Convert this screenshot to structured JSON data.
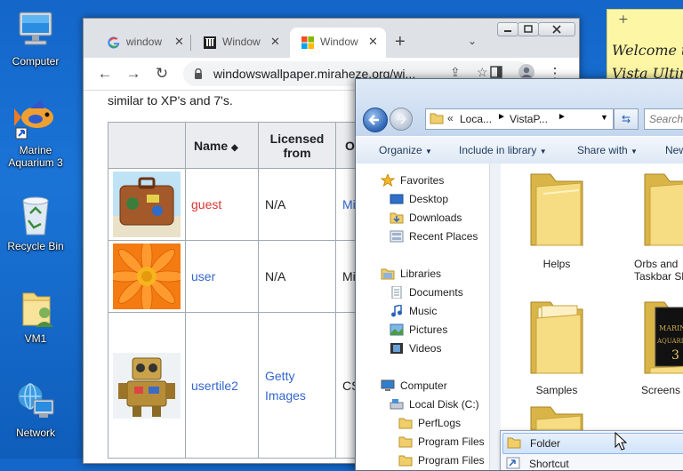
{
  "desktop": {
    "icons": [
      {
        "label": "Computer"
      },
      {
        "label": "Marine Aquarium 3"
      },
      {
        "label": "Recycle Bin"
      },
      {
        "label": "VM1"
      },
      {
        "label": "Network"
      }
    ]
  },
  "sticky": {
    "lines": [
      "Welcome to",
      "Vista Ultim"
    ]
  },
  "chrome": {
    "tabs": [
      {
        "title": "window",
        "active": false
      },
      {
        "title": "Window",
        "active": false
      },
      {
        "title": "Window",
        "active": true
      }
    ],
    "url": "windowswallpaper.miraheze.org/wi...",
    "page": {
      "intro": "similar to XP's and 7's.",
      "headers": [
        "Name",
        "Licensed from",
        "Ori"
      ],
      "rows": [
        {
          "name": "guest",
          "licensed": "N/A",
          "origin": "Mic",
          "thumb": "suitcase"
        },
        {
          "name": "user",
          "licensed": "N/A",
          "origin": "Mic",
          "thumb": "flower"
        },
        {
          "name": "usertile2",
          "licensed": "Getty Images",
          "origin": "CSA",
          "thumb": "robot"
        }
      ]
    }
  },
  "explorer": {
    "breadcrumb": [
      "Loca...",
      "VistaP..."
    ],
    "search_placeholder": "Search",
    "commands": [
      "Organize",
      "Include in library",
      "Share with",
      "New"
    ],
    "nav": {
      "favorites_label": "Favorites",
      "favorites": [
        "Desktop",
        "Downloads",
        "Recent Places"
      ],
      "libraries_label": "Libraries",
      "libraries": [
        "Documents",
        "Music",
        "Pictures",
        "Videos"
      ],
      "computer_label": "Computer",
      "drive": "Local Disk (C:)",
      "folders": [
        "PerfLogs",
        "Program Files",
        "Program Files"
      ]
    },
    "items": [
      {
        "label": "Helps"
      },
      {
        "label": "Orbs and Taskbar Skin"
      },
      {
        "label": "Samples"
      },
      {
        "label": "Screens"
      }
    ],
    "context_menu": [
      "Folder",
      "Shortcut"
    ]
  }
}
